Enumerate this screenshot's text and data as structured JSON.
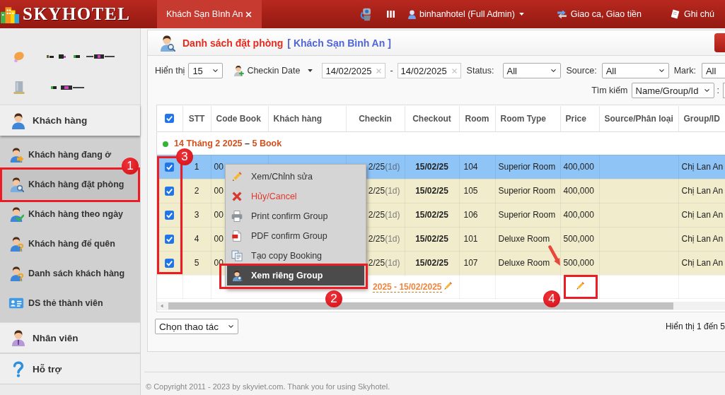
{
  "top_bar": {
    "logo": "SKYHOTEL",
    "tabs": [
      {
        "label": "Khách Sạn Bình An",
        "selected": true
      }
    ],
    "user": "binhanhotel (Full Admin)",
    "links": [
      {
        "label": "Giao ca, Giao tiền"
      },
      {
        "label": "Ghi chú"
      }
    ]
  },
  "sidebar": {
    "items": [
      {
        "kind": "garbled"
      },
      {
        "kind": "garbled"
      },
      {
        "kind": "section",
        "label": "Khách hàng",
        "expanded": true,
        "children": [
          {
            "label": "Khách hàng đang ở",
            "selected": false
          },
          {
            "label": "Khách hàng đặt phòng",
            "selected": true,
            "callout": "1"
          },
          {
            "label": "Khách hàng theo ngày",
            "selected": false
          },
          {
            "label": "Khách hàng để quên",
            "selected": false
          },
          {
            "label": "Danh sách khách hàng",
            "selected": false
          },
          {
            "label": "DS thẻ thành viên",
            "selected": false
          }
        ]
      },
      {
        "kind": "section",
        "label": "Nhân viên",
        "expanded": false
      },
      {
        "kind": "section",
        "label": "Hỗ trợ",
        "expanded": false
      }
    ]
  },
  "page_header": {
    "title": "Danh sách đặt phòng",
    "hotel": "[ Khách Sạn Bình An ]"
  },
  "filters": {
    "show": {
      "label": "Hiển thị",
      "value": "15"
    },
    "date_type": "Checkin Date",
    "date_from": "14/02/2025",
    "date_separator": "-",
    "date_to": "14/02/2025",
    "selects": [
      {
        "label": "Status:",
        "value": "All"
      },
      {
        "label": "Source:",
        "value": "All"
      },
      {
        "label": "Mark:",
        "value": "All"
      }
    ],
    "search": {
      "label": "Tìm kiếm",
      "value": "Name/Group/Id",
      "colon": ":"
    }
  },
  "table": {
    "all_checked": true,
    "checkbox_callout": "3",
    "columns": [
      "STT",
      "Code Book",
      "Khách hàng",
      "Checkin",
      "Checkout",
      "Room",
      "Room Type",
      "Price",
      "Source/Phân loại",
      "Group/ID"
    ],
    "group": {
      "date": "14 Tháng 2 2025",
      "separator": "–",
      "count": "5 Book"
    },
    "rows": [
      {
        "checked": true,
        "selected": true,
        "stt": "1",
        "code_book": "00",
        "checkin": "2/25",
        "nights": "(1d)",
        "checkout": "15/02/25",
        "room": "104",
        "room_type": "Superior Room",
        "price": "400,000",
        "group_id": "Chị Lan An"
      },
      {
        "checked": true,
        "selected": false,
        "stt": "2",
        "code_book": "00",
        "checkin": "2/25",
        "nights": "(1d)",
        "checkout": "15/02/25",
        "room": "105",
        "room_type": "Superior Room",
        "price": "400,000",
        "group_id": "Chị Lan An"
      },
      {
        "checked": true,
        "selected": false,
        "stt": "3",
        "code_book": "00",
        "checkin": "2/25",
        "nights": "(1d)",
        "checkout": "15/02/25",
        "room": "106",
        "room_type": "Superior Room",
        "price": "400,000",
        "group_id": "Chị Lan An"
      },
      {
        "checked": true,
        "selected": false,
        "stt": "4",
        "code_book": "00",
        "checkin": "2/25",
        "nights": "(1d)",
        "checkout": "15/02/25",
        "room": "101",
        "room_type": "Deluxe Room",
        "price": "500,000",
        "group_id": "Chị Lan An"
      },
      {
        "checked": true,
        "selected": false,
        "stt": "5",
        "code_book": "00",
        "checkin": "2/25",
        "nights": "(1d)",
        "checkout": "15/02/25",
        "room": "107",
        "room_type": "Deluxe Room",
        "price": "500,000",
        "group_id": "Chị Lan An"
      }
    ],
    "summary": {
      "dates": "2025 - 15/02/2025",
      "edit_callout": "4"
    }
  },
  "context_menu": {
    "items": [
      {
        "label": "Xem/Chỉnh sửa",
        "danger": false,
        "selected": false
      },
      {
        "label": "Hủy/Cancel",
        "danger": true,
        "selected": false
      },
      {
        "label": "Print confirm Group",
        "danger": false,
        "selected": false
      },
      {
        "label": "PDF confirm Group",
        "danger": false,
        "selected": false
      },
      {
        "label": "Tạo copy Booking",
        "danger": false,
        "selected": false
      },
      {
        "label": "Xem riêng Group",
        "danger": false,
        "selected": true,
        "callout": "2"
      }
    ]
  },
  "bulk_action": "Chọn thao tác",
  "pagination_info": "Hiển thị 1 đến 5",
  "footer": "© Copyright 2011 - 2023 by skyviet.com. Thank you for using Skyhotel."
}
